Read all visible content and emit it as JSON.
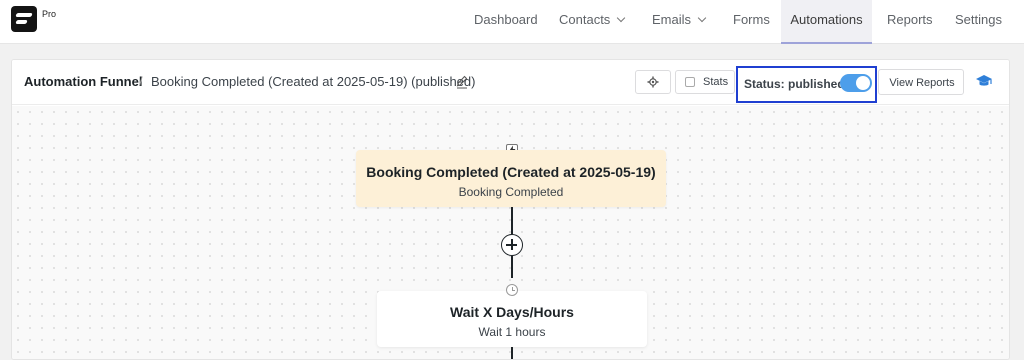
{
  "brand": {
    "badge": "Pro",
    "icon": "fluentcrm-logo-icon"
  },
  "nav": {
    "items": [
      {
        "label": "Dashboard",
        "has_dropdown": false,
        "active": false
      },
      {
        "label": "Contacts",
        "has_dropdown": true,
        "active": false
      },
      {
        "label": "Emails",
        "has_dropdown": true,
        "active": false
      },
      {
        "label": "Forms",
        "has_dropdown": false,
        "active": false
      },
      {
        "label": "Automations",
        "has_dropdown": false,
        "active": true
      },
      {
        "label": "Reports",
        "has_dropdown": false,
        "active": false
      },
      {
        "label": "Settings",
        "has_dropdown": false,
        "active": false
      }
    ]
  },
  "header": {
    "breadcrumb_root": "Automation Funnel",
    "separator": "/",
    "funnel_title": "Booking Completed (Created at 2025-05-19) (published)",
    "stats_label": "Stats",
    "status_label": "Status: published",
    "status_on": true,
    "view_reports_label": "View Reports"
  },
  "workflow": {
    "trigger": {
      "title": "Booking Completed (Created at 2025-05-19)",
      "subtitle": "Booking Completed"
    },
    "steps": [
      {
        "title": "Wait X Days/Hours",
        "subtitle": "Wait 1 hours"
      }
    ]
  },
  "colors": {
    "accent": "#4d9eea",
    "highlight_border": "#1f3fd1",
    "trigger_bg": "#fdf0d7",
    "active_tab_underline": "#9ea3d9"
  }
}
